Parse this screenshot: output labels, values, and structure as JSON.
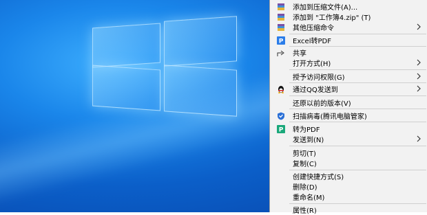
{
  "context_menu": {
    "items": [
      {
        "label": "添加到压缩文件(A)...",
        "icon": "winrar-icon"
      },
      {
        "label": "添加到 \"工作簿4.zip\" (T)",
        "icon": "winrar-icon"
      },
      {
        "label": "其他压缩命令",
        "icon": "winrar-icon"
      },
      {
        "label": "Excel转PDF",
        "icon": "pdf-p-blue-icon"
      },
      {
        "label": "共享",
        "icon": "share-icon"
      },
      {
        "label": "打开方式(H)"
      },
      {
        "label": "授予访问权限(G)"
      },
      {
        "label": "通过QQ发送到",
        "icon": "qq-penguin-icon"
      },
      {
        "label": "还原以前的版本(V)"
      },
      {
        "label": "扫描病毒(腾讯电脑管家)",
        "icon": "tencent-shield-icon"
      },
      {
        "label": "转为PDF",
        "icon": "pdf-p-green-icon"
      },
      {
        "label": "发送到(N)"
      },
      {
        "label": "剪切(T)"
      },
      {
        "label": "复制(C)"
      },
      {
        "label": "创建快捷方式(S)"
      },
      {
        "label": "删除(D)"
      },
      {
        "label": "重命名(M)"
      },
      {
        "label": "属性(R)"
      }
    ]
  }
}
